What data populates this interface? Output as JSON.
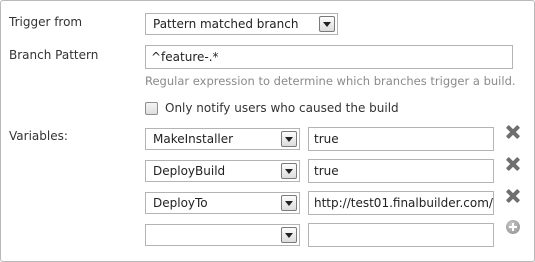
{
  "trigger": {
    "label": "Trigger from",
    "selected": "Pattern matched branch"
  },
  "branch_pattern": {
    "label": "Branch Pattern",
    "value": "^feature-.*",
    "help": "Regular expression to determine which branches trigger a build."
  },
  "notify": {
    "label": "Only notify users who caused the build",
    "checked": false
  },
  "variables": {
    "label": "Variables:",
    "rows": [
      {
        "name": "MakeInstaller",
        "value": "true"
      },
      {
        "name": "DeployBuild",
        "value": "true"
      },
      {
        "name": "DeployTo",
        "value": "http://test01.finalbuilder.com/"
      },
      {
        "name": "",
        "value": ""
      }
    ]
  },
  "icons": {
    "remove": "close-icon",
    "add": "plus-circle-icon",
    "dropdown": "chevron-down-icon"
  }
}
